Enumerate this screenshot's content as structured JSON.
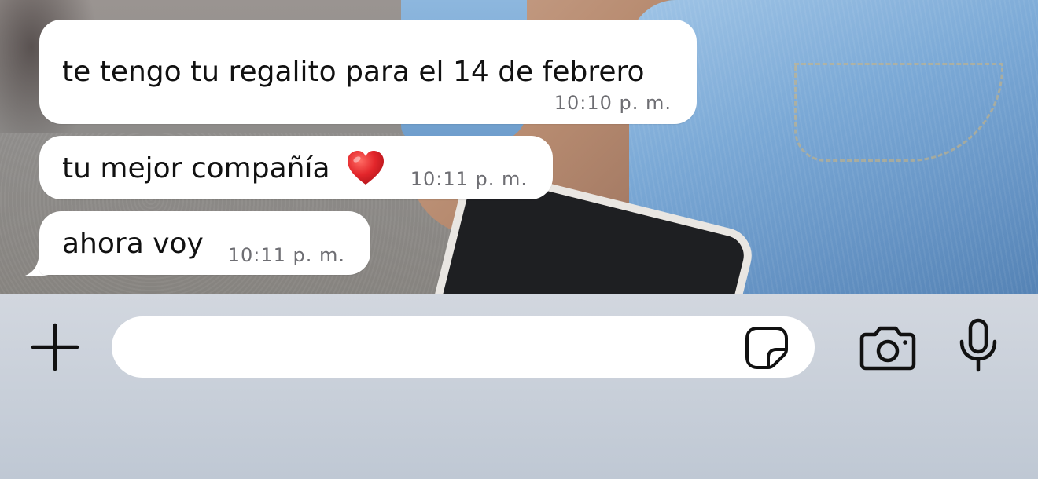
{
  "messages": [
    {
      "text": "te tengo tu regalito para el 14 de febrero",
      "time": "10:10 p. m."
    },
    {
      "text": "tu mejor compañía",
      "time": "10:11 p. m.",
      "emoji": "red-heart"
    },
    {
      "text": "ahora voy",
      "time": "10:11 p. m."
    }
  ],
  "composer": {
    "placeholder": "",
    "value": "",
    "icons": {
      "attach": "plus-icon",
      "sticker": "sticker-icon",
      "camera": "camera-icon",
      "microphone": "microphone-icon"
    }
  },
  "colors": {
    "bubble": "#ffffff",
    "message_text": "#111111",
    "timestamp": "#6e6e73",
    "input_bar": "#cdd3dc",
    "icon": "#111111",
    "heart": "#e3262b"
  }
}
